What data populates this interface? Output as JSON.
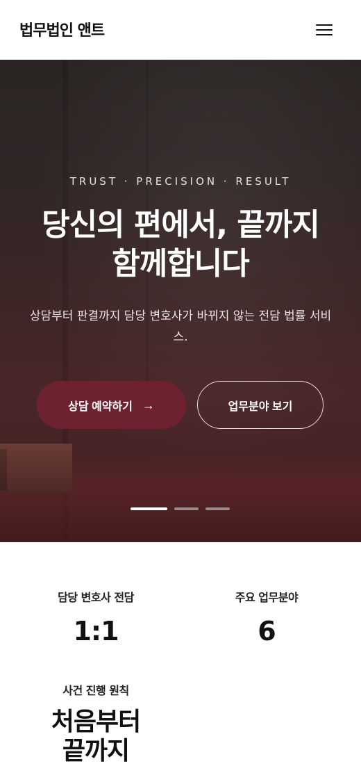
{
  "header": {
    "logo": "법무법인 앤트",
    "menu_icon": "hamburger-menu-icon"
  },
  "hero": {
    "tagline": "TRUST · PRECISION · RESULT",
    "title_line1": "당신의 편에서, 끝까지",
    "title_line2": "함께합니다",
    "subtitle": "상담부터 판결까지 담당 변호사가 바뀌지 않는 전담 법률 서비스.",
    "primary_button": "상담 예약하기",
    "primary_button_icon": "arrow-right-icon",
    "secondary_button": "업무분야 보기",
    "slides_total": 3,
    "active_slide": 1
  },
  "stats": [
    {
      "label": "담당 변호사 전담",
      "value": "1:1"
    },
    {
      "label": "주요 업무분야",
      "value": "6"
    },
    {
      "label": "사건 진행 원칙",
      "value_line1": "처음부터",
      "value_line2": "끝까지"
    }
  ],
  "colors": {
    "accent": "#6e2230",
    "hero_bg": "#3b2626",
    "dot_active": "#ffffff",
    "dot_inactive": "#9a8a8a"
  }
}
